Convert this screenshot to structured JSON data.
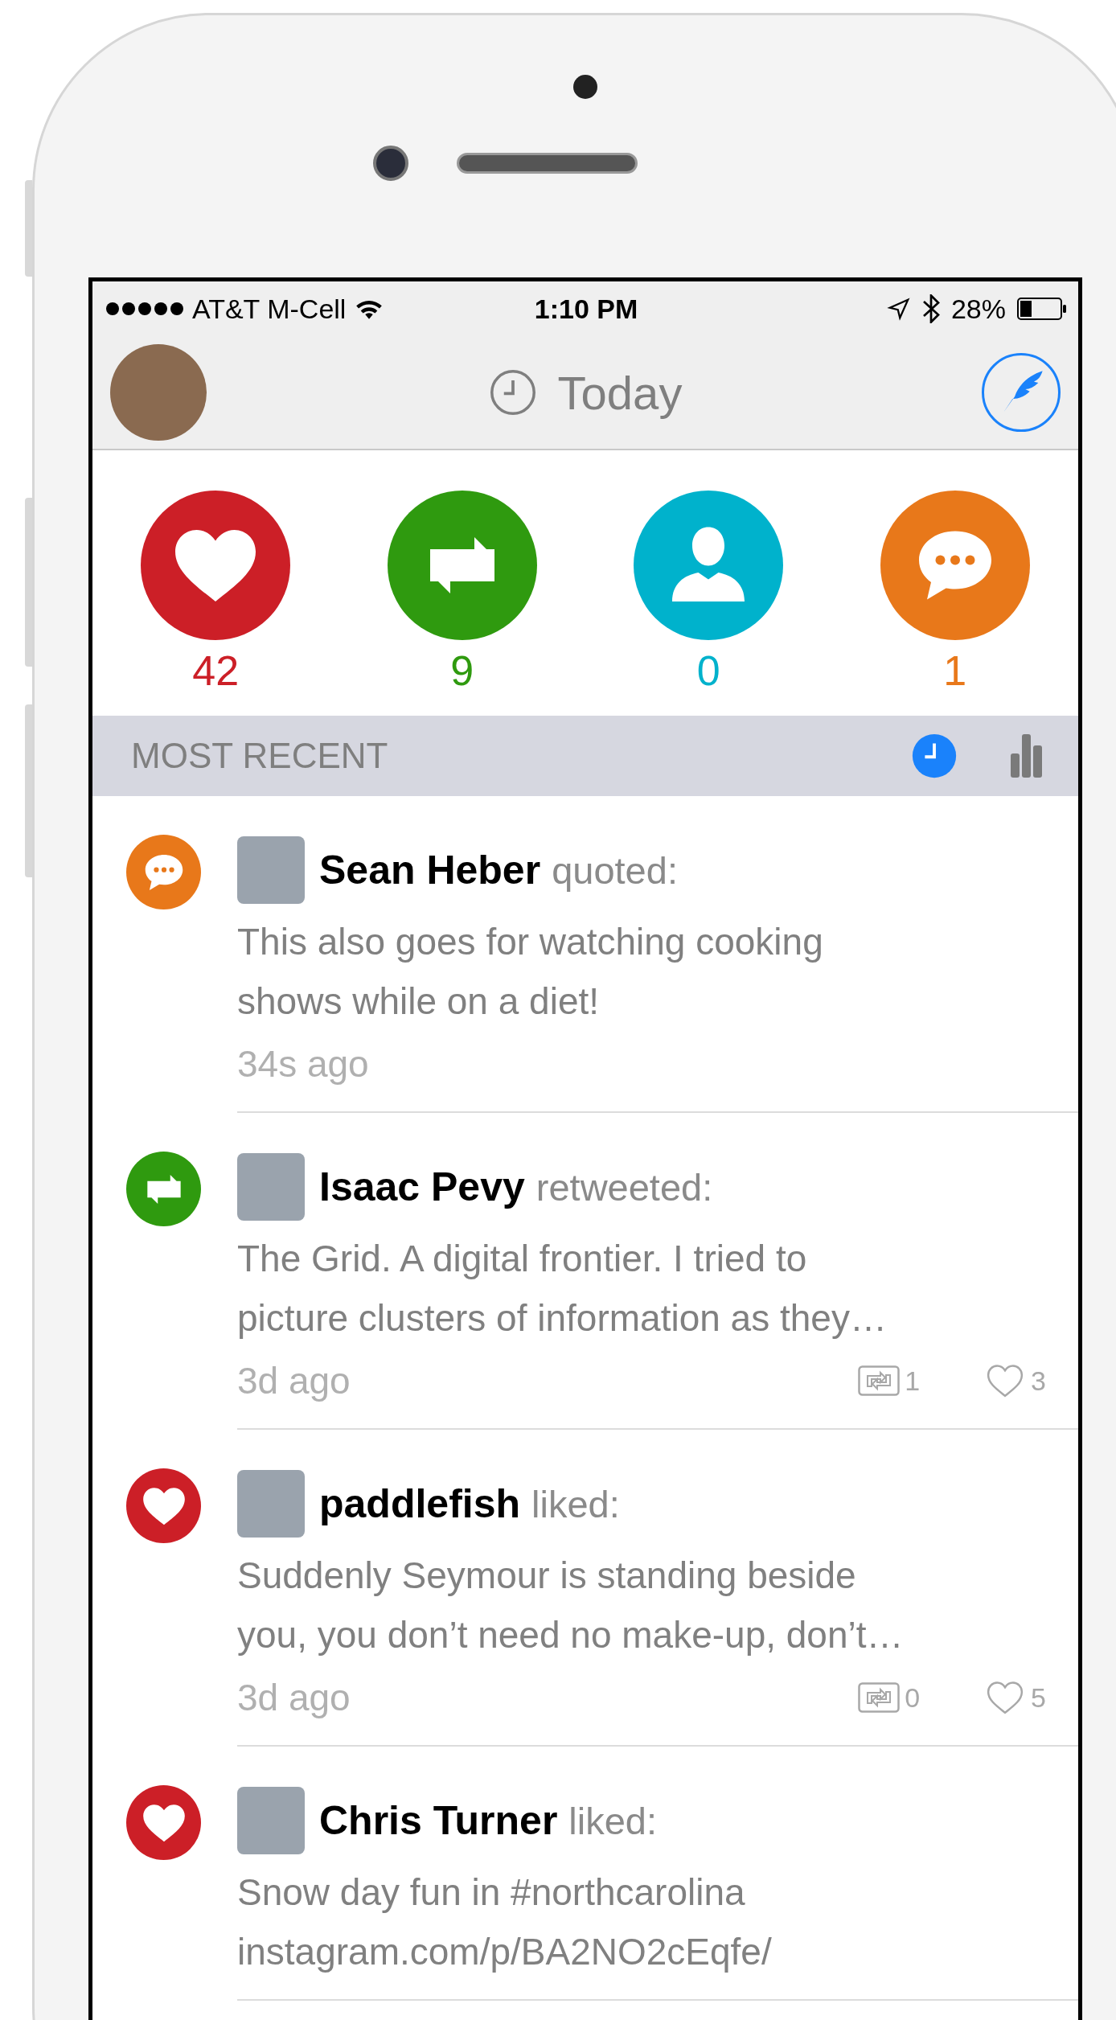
{
  "status_bar": {
    "carrier": "AT&T M-Cell",
    "time": "1:10 PM",
    "battery": "28%"
  },
  "header": {
    "title": "Today"
  },
  "stats": [
    {
      "kind": "like",
      "count": "42",
      "color": "#cc1f27"
    },
    {
      "kind": "retweet",
      "count": "9",
      "color": "#2f9a0f"
    },
    {
      "kind": "follow",
      "count": "0",
      "color": "#00b2cc"
    },
    {
      "kind": "reply",
      "count": "1",
      "color": "#e8781a"
    }
  ],
  "section": {
    "title": "MOST RECENT",
    "views": [
      {
        "kind": "recent",
        "selected": true
      },
      {
        "kind": "stats",
        "selected": false
      }
    ]
  },
  "activity": [
    {
      "kind": "quote",
      "name": "Sean Heber",
      "action": "quoted:",
      "lines": [
        "This also goes for watching cooking",
        "shows while on a diet!"
      ],
      "time": "34s ago"
    },
    {
      "kind": "retweet",
      "name": "Isaac Pevy",
      "action": "retweeted:",
      "lines": [
        "The Grid. A digital frontier. I tried to",
        "picture clusters of information as they…"
      ],
      "time": "3d ago",
      "retweets": "1",
      "likes": "3"
    },
    {
      "kind": "like",
      "name": "paddlefish",
      "action": "liked:",
      "lines": [
        "Suddenly Seymour is standing beside",
        "you, you don’t need no make-up, don’t…"
      ],
      "time": "3d ago",
      "retweets": "0",
      "likes": "5"
    },
    {
      "kind": "like",
      "name": "Chris Turner",
      "action": "liked:",
      "lines": [
        "Snow day fun in #northcarolina",
        "instagram.com/p/BA2NO2cEqfe/"
      ]
    }
  ]
}
